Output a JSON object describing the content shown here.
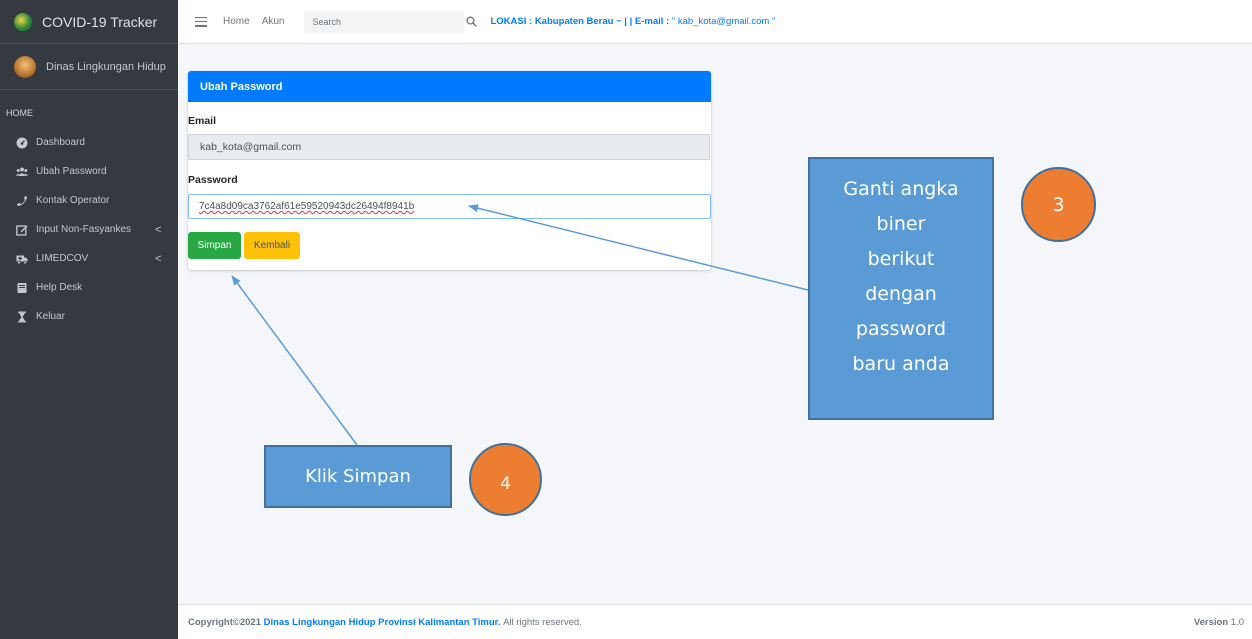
{
  "brand": {
    "title": "COVID-19 Tracker"
  },
  "user": {
    "name": "Dinas Lingkungan Hidup"
  },
  "sidebar": {
    "header": "HOME",
    "items": [
      {
        "label": "Dashboard",
        "icon": "dashboard-icon"
      },
      {
        "label": "Ubah Password",
        "icon": "users-icon"
      },
      {
        "label": "Kontak Operator",
        "icon": "phone-icon"
      },
      {
        "label": "Input Non-Fasyankes",
        "icon": "edit-icon",
        "caret": "<"
      },
      {
        "label": "LIMEDCOV",
        "icon": "ambulance-icon",
        "caret": "<"
      },
      {
        "label": "Help Desk",
        "icon": "book-icon"
      },
      {
        "label": "Keluar",
        "icon": "hourglass-icon"
      }
    ]
  },
  "topbar": {
    "home": "Home",
    "akun": "Akun",
    "search_placeholder": "Search",
    "lokasi_label": "LOKASI : Kabupaten Berau ~ | | E-mail :",
    "lokasi_email": " \" kab_kota@gmail.com \""
  },
  "form": {
    "title": "Ubah Password",
    "email_label": "Email",
    "email_value": "kab_kota@gmail.com",
    "password_label": "Password",
    "password_value": "7c4a8d09ca3762af61e59520943dc26494f8941b",
    "save_label": "Simpan",
    "back_label": "Kembali"
  },
  "annotations": {
    "step3_lines": [
      "Ganti angka",
      "biner",
      "berikut",
      "dengan",
      "password",
      "baru anda"
    ],
    "step3_number": "3",
    "step4_text": "Klik Simpan",
    "step4_number": "4"
  },
  "footer": {
    "copyright": "Copyright©2021",
    "org": "Dinas Lingkungan Hidup Provinsi Kalimantan Timur.",
    "rights": "All rights reserved.",
    "version_label": "Version",
    "version_value": "1.0"
  },
  "colors": {
    "sidebar": "#343a40",
    "primary": "#007bff",
    "success": "#28a745",
    "warning": "#ffc107",
    "callout": "#5b9bd5",
    "badge": "#ed7d31"
  }
}
